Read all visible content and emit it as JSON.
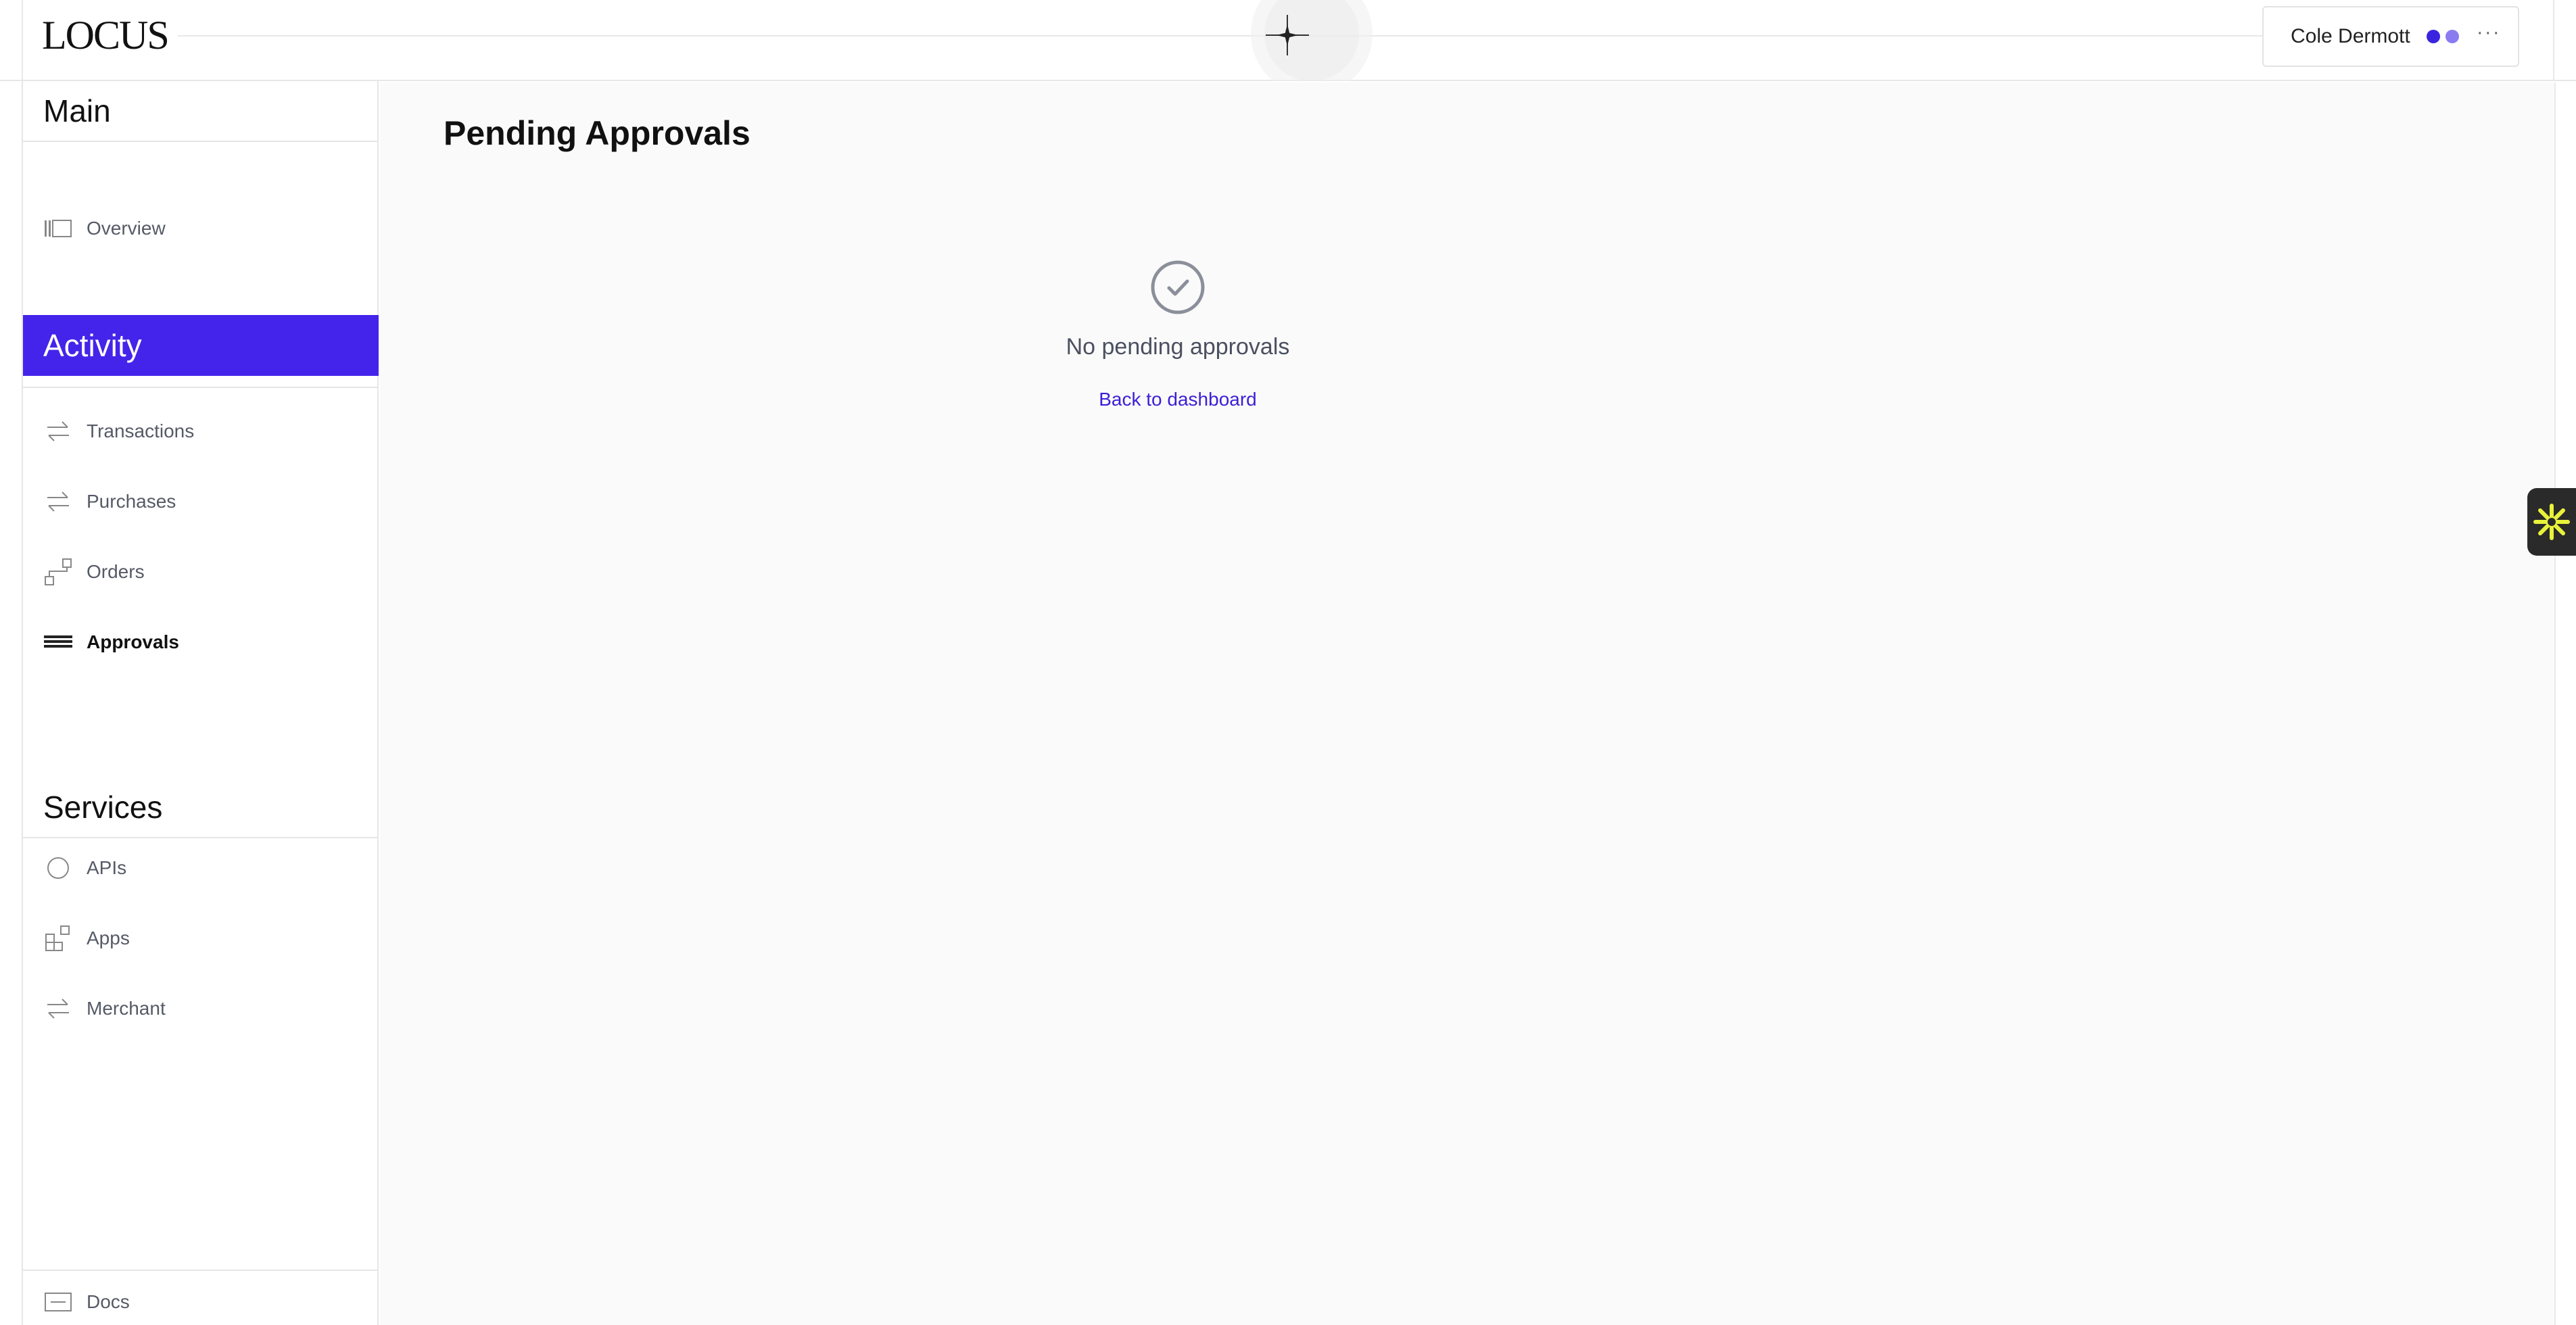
{
  "app": {
    "logo": "LOCUS",
    "accent_color": "#4424ea"
  },
  "header": {
    "user_name": "Cole Dermott",
    "status_dot_colors": [
      "#3b24e0",
      "#8a7cf0"
    ],
    "more_label": "···"
  },
  "sidebar": {
    "sections": [
      {
        "title": "Main",
        "active": false
      },
      {
        "title": "Activity",
        "active": true
      },
      {
        "title": "Services",
        "active": false
      }
    ],
    "main_items": [
      {
        "label": "Overview",
        "icon": "layout-icon"
      }
    ],
    "activity_items": [
      {
        "label": "Transactions",
        "icon": "swap-arrows-icon"
      },
      {
        "label": "Purchases",
        "icon": "swap-arrows-icon"
      },
      {
        "label": "Orders",
        "icon": "nodes-icon"
      },
      {
        "label": "Approvals",
        "icon": "stack-lines-icon",
        "current": true
      }
    ],
    "services_items": [
      {
        "label": "APIs",
        "icon": "circle-icon"
      },
      {
        "label": "Apps",
        "icon": "grid-apps-icon"
      },
      {
        "label": "Merchant",
        "icon": "swap-arrows-icon"
      }
    ],
    "footer_item": {
      "label": "Docs",
      "icon": "doc-icon"
    }
  },
  "main": {
    "title": "Pending Approvals",
    "empty_state": {
      "icon": "check-circle-icon",
      "message": "No pending approvals",
      "link_label": "Back to dashboard"
    }
  },
  "widget": {
    "icon": "asterisk-icon",
    "color": "#e8f23a"
  }
}
